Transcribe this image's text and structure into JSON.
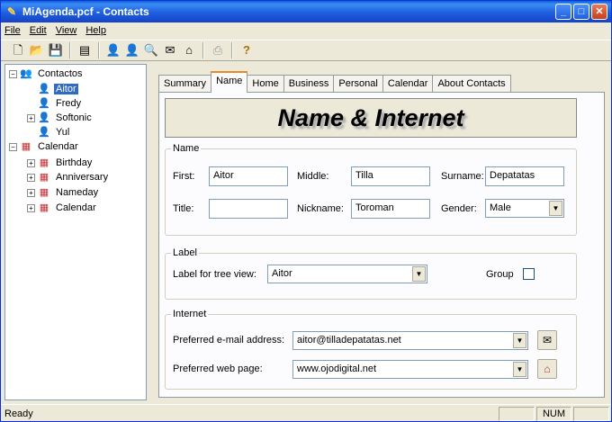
{
  "window": {
    "title": "MiAgenda.pcf - Contacts"
  },
  "menu": [
    "File",
    "Edit",
    "View",
    "Help"
  ],
  "toolbar_icons": [
    "new-icon",
    "open-icon",
    "save-icon",
    "card-icon",
    "contact-icon",
    "contact-red-icon",
    "search-icon",
    "email-icon",
    "home-icon",
    "print-icon",
    "help-icon"
  ],
  "tree": {
    "contactos": "Contactos",
    "contacts": [
      "Aitor",
      "Fredy",
      "Softonic",
      "Yul"
    ],
    "calendar": "Calendar",
    "calendar_items": [
      "Birthday",
      "Anniversary",
      "Nameday",
      "Calendar"
    ]
  },
  "tabs": [
    "Summary",
    "Name",
    "Home",
    "Business",
    "Personal",
    "Calendar",
    "About Contacts"
  ],
  "active_tab": "Name",
  "banner": "Name & Internet",
  "name_group": {
    "legend": "Name",
    "first_label": "First:",
    "first_value": "Aitor",
    "middle_label": "Middle:",
    "middle_value": "Tilla",
    "surname_label": "Surname:",
    "surname_value": "Depatatas",
    "title_label": "Title:",
    "title_value": "",
    "nickname_label": "Nickname:",
    "nickname_value": "Toroman",
    "gender_label": "Gender:",
    "gender_value": "Male"
  },
  "label_group": {
    "legend": "Label",
    "tree_label": "Label for tree view:",
    "tree_value": "Aitor",
    "group_label": "Group"
  },
  "internet_group": {
    "legend": "Internet",
    "email_label": "Preferred e-mail address:",
    "email_value": "aitor@tilladepatatas.net",
    "web_label": "Preferred web page:",
    "web_value": "www.ojodigital.net"
  },
  "status": {
    "text": "Ready",
    "num": "NUM"
  },
  "colors": {
    "title_bar": "#1d5fe0",
    "selection": "#316ac5",
    "tab_highlight": "#e68b2c"
  }
}
